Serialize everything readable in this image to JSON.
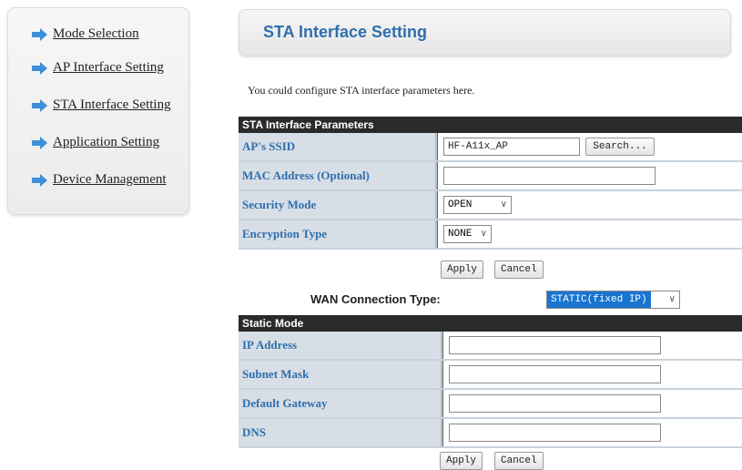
{
  "sidebar": {
    "items": [
      {
        "label": "Mode Selection"
      },
      {
        "label": "AP Interface Setting"
      },
      {
        "label": "STA Interface Setting"
      },
      {
        "label": "Application Setting"
      },
      {
        "label": "Device Management"
      }
    ],
    "accent_color": "#3d8fd6"
  },
  "page": {
    "title": "STA Interface Setting",
    "description": "You could configure STA interface parameters here."
  },
  "sta_params": {
    "header": "STA Interface Parameters",
    "ssid_label": "AP's SSID",
    "ssid_value": "HF-A11x_AP",
    "search_label": "Search...",
    "mac_label": "MAC Address (Optional)",
    "mac_value": "",
    "security_label": "Security Mode",
    "security_value": "OPEN",
    "encryption_label": "Encryption Type",
    "encryption_value": "NONE",
    "apply_label": "Apply",
    "cancel_label": "Cancel"
  },
  "wan": {
    "label": "WAN Connection Type:",
    "value": "STATIC(fixed IP)",
    "highlight_color": "#1874d0"
  },
  "static_mode": {
    "header": "Static Mode",
    "ip_label": "IP Address",
    "subnet_label": "Subnet Mask",
    "gateway_label": "Default Gateway",
    "dns_label": "DNS",
    "apply_label": "Apply",
    "cancel_label": "Cancel"
  }
}
